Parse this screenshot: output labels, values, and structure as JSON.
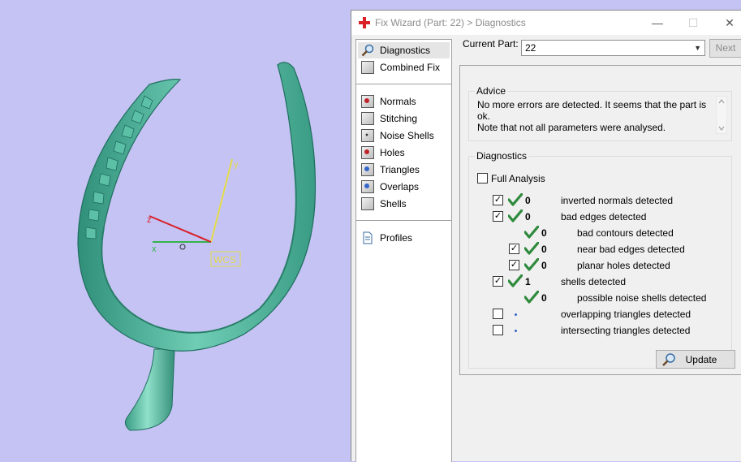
{
  "window": {
    "title": "Fix Wizard (Part: 22) > Diagnostics",
    "controls": {
      "minimize": "—",
      "maximize": "☐",
      "close": "✕"
    }
  },
  "viewport": {
    "axis_labels": {
      "x": "x",
      "y": "y",
      "z": "z"
    },
    "wcs_label": "WCS"
  },
  "nav": {
    "top_items": [
      {
        "label": "Diagnostics",
        "icon": "magnifier-icon",
        "selected": true
      },
      {
        "label": "Combined Fix",
        "icon": "combined-fix-icon"
      }
    ],
    "fix_items": [
      {
        "label": "Normals",
        "icon": "normals-icon"
      },
      {
        "label": "Stitching",
        "icon": "stitching-icon"
      },
      {
        "label": "Noise Shells",
        "icon": "noise-shells-icon"
      },
      {
        "label": "Holes",
        "icon": "holes-icon"
      },
      {
        "label": "Triangles",
        "icon": "triangles-icon"
      },
      {
        "label": "Overlaps",
        "icon": "overlaps-icon"
      },
      {
        "label": "Shells",
        "icon": "shells-icon"
      }
    ],
    "bottom_items": [
      {
        "label": "Profiles",
        "icon": "profiles-icon"
      }
    ]
  },
  "part": {
    "label": "Current Part:",
    "value": "22",
    "next_label": "Next"
  },
  "advice": {
    "title": "Advice",
    "lines": [
      "No more errors are detected. It seems that the part is ok.",
      "Note that not all parameters were analysed."
    ]
  },
  "diagnostics": {
    "title": "Diagnostics",
    "full_analysis": {
      "label": "Full Analysis",
      "checked": false
    },
    "rows": [
      {
        "checked": true,
        "status": "ok",
        "count": "0",
        "label": "inverted normals detected"
      },
      {
        "checked": true,
        "status": "ok",
        "count": "0",
        "label": "bad edges detected"
      },
      {
        "checked": null,
        "status": "ok",
        "count": "0",
        "label": "bad contours detected"
      },
      {
        "checked": true,
        "status": "ok",
        "count": "0",
        "label": "near bad edges detected"
      },
      {
        "checked": true,
        "status": "ok",
        "count": "0",
        "label": "planar holes detected"
      },
      {
        "checked": true,
        "status": "ok",
        "count": "1",
        "label": "shells detected"
      },
      {
        "checked": null,
        "status": "ok",
        "count": "0",
        "label": "possible noise shells detected"
      },
      {
        "checked": false,
        "status": "pending",
        "count": "",
        "label": "overlapping triangles detected"
      },
      {
        "checked": false,
        "status": "pending",
        "count": "",
        "label": "intersecting triangles detected"
      }
    ],
    "update_label": "Update"
  },
  "colors": {
    "viewport_bg": "#c4c3f4",
    "model": "#4fb39c",
    "check": "#2e8a3c",
    "accent_red": "#d92027"
  }
}
